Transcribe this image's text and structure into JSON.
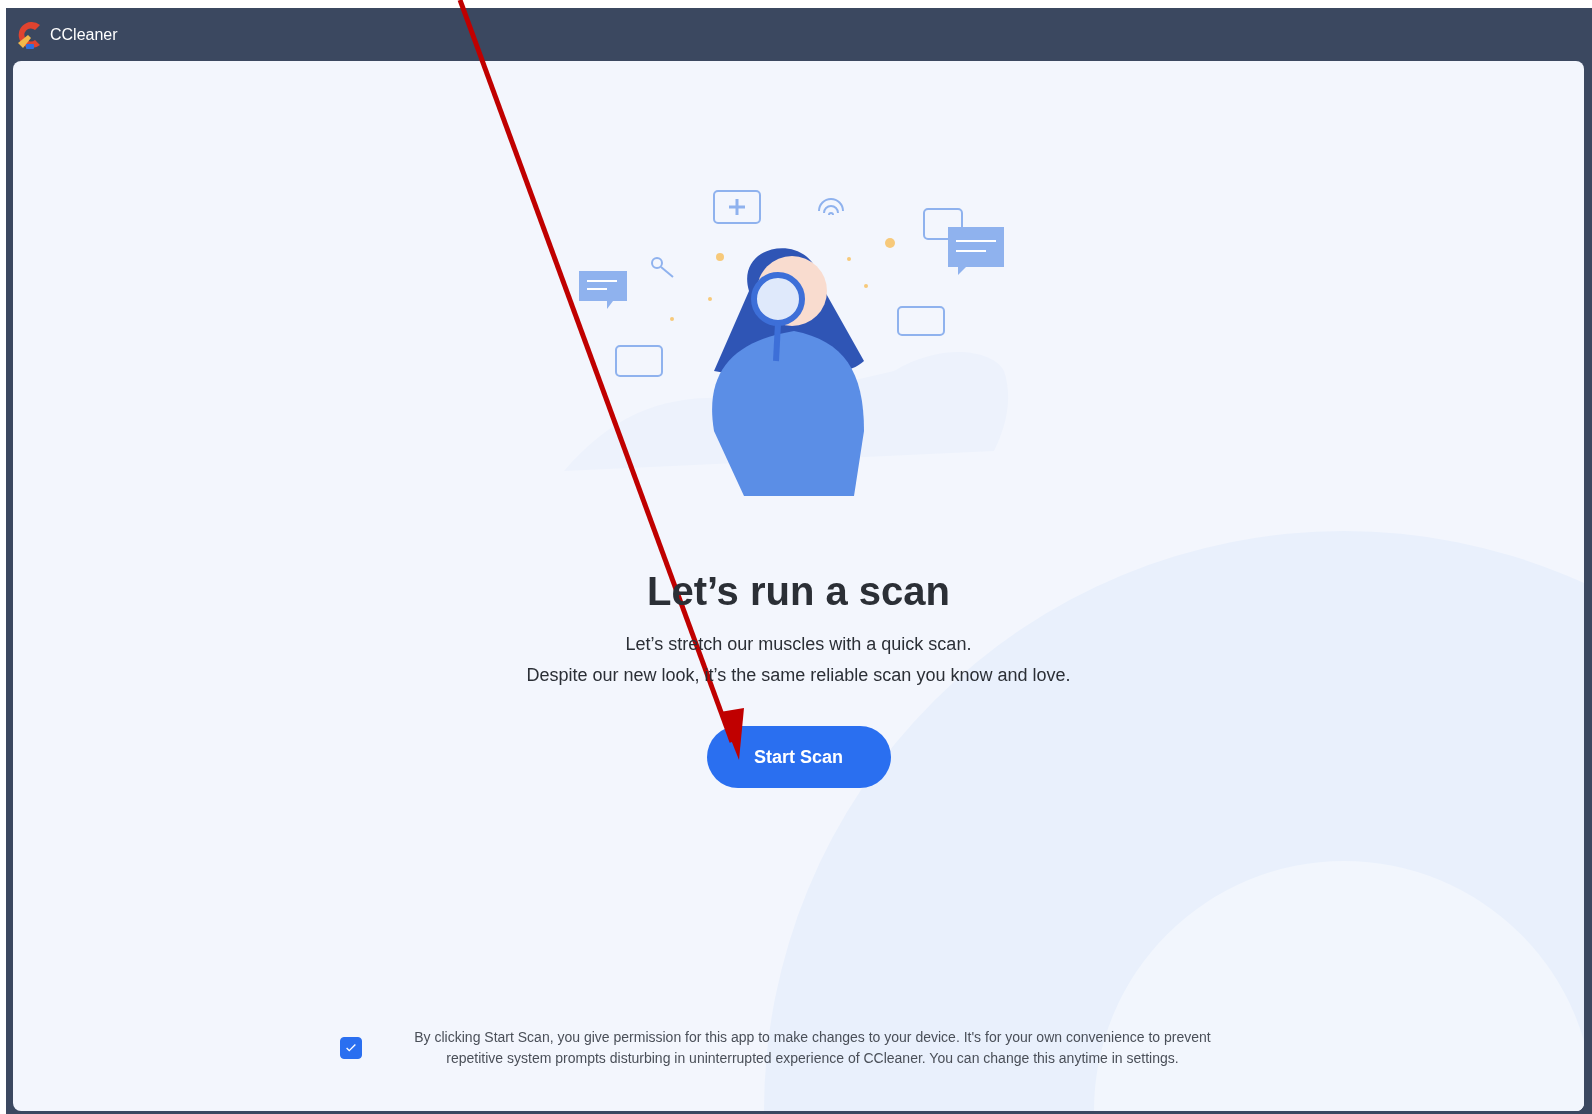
{
  "window": {
    "title": "CCleaner"
  },
  "heading": "Let’s run a scan",
  "subtitle_lines": [
    "Let’s stretch our muscles with a quick scan.",
    "Despite our new look, it’s the same reliable scan you know and love."
  ],
  "primary_button": {
    "label": "Start Scan"
  },
  "consent": {
    "checked": true,
    "text": "By clicking Start Scan, you give permission for this app to make changes to your device. It's for your own convenience to prevent repetitive system prompts disturbing in uninterrupted experience of CCleaner. You can change this anytime in settings."
  }
}
